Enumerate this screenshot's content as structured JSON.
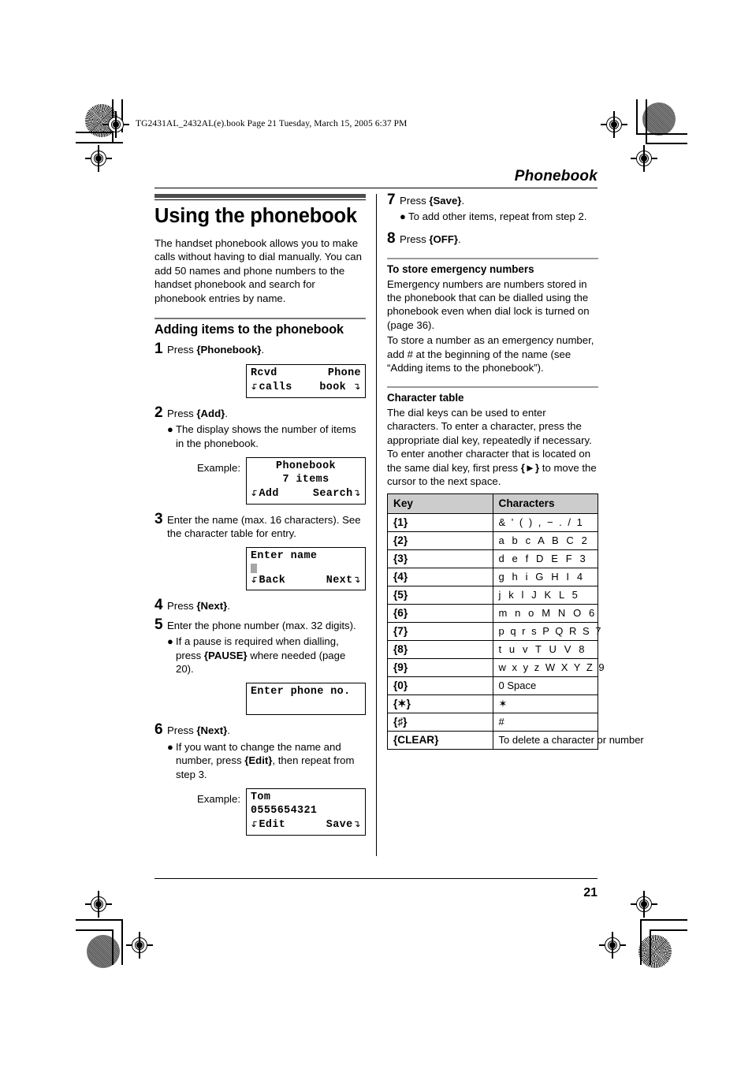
{
  "file_stamp": "TG2431AL_2432AL(e).book  Page 21  Tuesday, March 15, 2005  6:37 PM",
  "header": {
    "title": "Phonebook"
  },
  "footer": {
    "page_number": "21"
  },
  "left_column": {
    "title": "Using the phonebook",
    "intro": "The handset phonebook allows you to make calls without having to dial manually. You can add 50 names and phone numbers to the handset phonebook and search for phonebook entries by name.",
    "section_title": "Adding items to the phonebook",
    "step1": {
      "num": "1",
      "pre": "Press ",
      "key": "{Phonebook}",
      "post": "."
    },
    "lcd1": {
      "line1_left": "Rcvd",
      "line1_right": "Phone",
      "line2_left": "calls",
      "line2_right": "book"
    },
    "step2": {
      "num": "2",
      "pre": "Press ",
      "key": "{Add}",
      "post": "."
    },
    "step2_bullet": "The display shows the number of items in the phonebook.",
    "example_label": "Example:",
    "lcd2": {
      "line1": "Phonebook",
      "line2": "7 items",
      "line3_left": "Add",
      "line3_right": "Search"
    },
    "step3": {
      "num": "3",
      "text": "Enter the name (max. 16 characters). See the character table for entry."
    },
    "lcd3": {
      "line1": "Enter name",
      "line3_left": "Back",
      "line3_right": "Next"
    },
    "step4": {
      "num": "4",
      "pre": "Press ",
      "key": "{Next}",
      "post": "."
    },
    "step5": {
      "num": "5",
      "text": "Enter the phone number (max. 32 digits)."
    },
    "step5_bullet": {
      "pre": "If a pause is required when dialling, press ",
      "key": "{PAUSE}",
      "post": " where needed (page 20)."
    },
    "lcd4": {
      "line1": "Enter phone no."
    },
    "step6": {
      "num": "6",
      "pre": "Press ",
      "key": "{Next}",
      "post": "."
    },
    "step6_bullet": {
      "pre": "If you want to change the name and number, press ",
      "key": "{Edit}",
      "post": ", then repeat from step 3."
    },
    "lcd5": {
      "line1": "Tom",
      "line2": "0555654321",
      "line3_left": "Edit",
      "line3_right": "Save"
    }
  },
  "right_column": {
    "step7": {
      "num": "7",
      "pre": "Press ",
      "key": "{Save}",
      "post": "."
    },
    "step7_bullet": "To add other items, repeat from step 2.",
    "step8": {
      "num": "8",
      "pre": "Press ",
      "key": "{OFF}",
      "post": "."
    },
    "emergency_heading": "To store emergency numbers",
    "emergency_p1": "Emergency numbers are numbers stored in the phonebook that can be dialled using the phonebook even when dial lock is turned on (page 36).",
    "emergency_p2": "To store a number as an emergency number, add # at the beginning of the name (see “Adding items to the phonebook”).",
    "chartable_heading": "Character table",
    "chartable_intro_pre": "The dial keys can be used to enter characters. To enter a character, press the appropriate dial key, repeatedly if necessary. To enter another character that is located on the same dial key, first press ",
    "chartable_intro_key": "{►}",
    "chartable_intro_post": " to move the cursor to the next space.",
    "table": {
      "headers": {
        "key": "Key",
        "characters": "Characters"
      },
      "rows": [
        {
          "key": "{1}",
          "chars": "&  '  (  )  ,  −  .  /  1",
          "style": "wide"
        },
        {
          "key": "{2}",
          "chars": "a  b  c  A  B  C  2",
          "style": "normal"
        },
        {
          "key": "{3}",
          "chars": "d  e  f  D  E  F  3",
          "style": "normal"
        },
        {
          "key": "{4}",
          "chars": "g  h  i  G  H  I  4",
          "style": "normal"
        },
        {
          "key": "{5}",
          "chars": "j  k  l  J  K  L  5",
          "style": "normal"
        },
        {
          "key": "{6}",
          "chars": "m  n  o  M  N  O  6",
          "style": "normal"
        },
        {
          "key": "{7}",
          "chars": "p  q  r  s  P  Q  R  S  7",
          "style": "wide"
        },
        {
          "key": "{8}",
          "chars": "t  u  v  T  U  V  8",
          "style": "normal"
        },
        {
          "key": "{9}",
          "chars": "w  x  y  z  W  X  Y  Z  9",
          "style": "wide"
        },
        {
          "key": "{0}",
          "chars": "0   Space",
          "style": "plain"
        },
        {
          "key": "{✶}",
          "chars": "✶",
          "style": "plain"
        },
        {
          "key": "{♯}",
          "chars": "#",
          "style": "plain"
        },
        {
          "key": "{CLEAR}",
          "chars": "To delete a character or number",
          "style": "plain"
        }
      ]
    }
  }
}
